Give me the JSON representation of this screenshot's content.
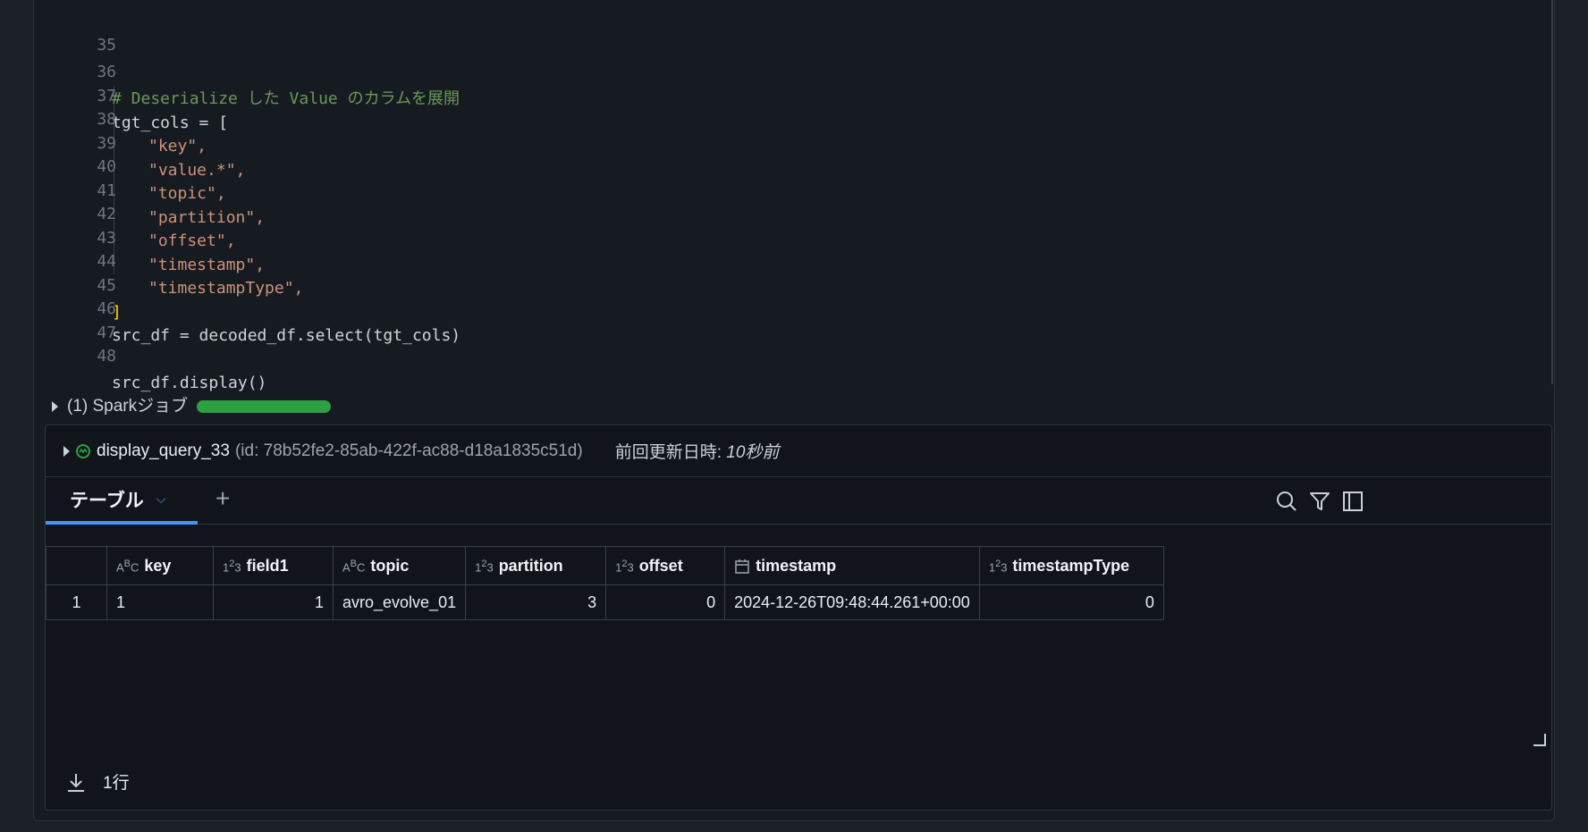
{
  "editor": {
    "lines": [
      {
        "no": "35",
        "text": ""
      },
      {
        "no": "36",
        "text": "# Deserialize した Value のカラムを展開"
      },
      {
        "no": "37",
        "text": "tgt_cols = ["
      },
      {
        "no": "38",
        "text": "\"key\","
      },
      {
        "no": "39",
        "text": "\"value.*\","
      },
      {
        "no": "40",
        "text": "\"topic\","
      },
      {
        "no": "41",
        "text": "\"partition\","
      },
      {
        "no": "42",
        "text": "\"offset\","
      },
      {
        "no": "43",
        "text": "\"timestamp\","
      },
      {
        "no": "44",
        "text": "\"timestampType\","
      },
      {
        "no": "45",
        "text": "]"
      },
      {
        "no": "46",
        "text": "src_df = decoded_df.select(tgt_cols)"
      },
      {
        "no": "47",
        "text": ""
      },
      {
        "no": "48",
        "text": "src_df.display()"
      }
    ]
  },
  "spark_job": {
    "label": "(1) Sparkジョブ",
    "progress": 1.0,
    "color": "#2ea043"
  },
  "result": {
    "query_name": "display_query_33",
    "query_id": "(id: 78b52fe2-85ab-422f-ac88-d18a1835c51d)",
    "updated_label": "前回更新日時: ",
    "updated_value": "10秒前",
    "tab_label": "テーブル",
    "add_tab": "+",
    "columns": [
      {
        "type": "ABC",
        "name": "key"
      },
      {
        "type": "123",
        "name": "field1"
      },
      {
        "type": "ABC",
        "name": "topic"
      },
      {
        "type": "123",
        "name": "partition"
      },
      {
        "type": "123",
        "name": "offset"
      },
      {
        "type": "calendar",
        "name": "timestamp"
      },
      {
        "type": "123",
        "name": "timestampType"
      }
    ],
    "rows": [
      {
        "index": "1",
        "key": "1",
        "field1": "1",
        "topic": "avro_evolve_01",
        "partition": "3",
        "offset": "0",
        "timestamp": "2024-12-26T09:48:44.261+00:00",
        "timestampType": "0"
      }
    ],
    "row_count": "1行"
  },
  "colors": {
    "accent": "#4493f8",
    "success": "#2ea043",
    "background": "#161b22"
  }
}
